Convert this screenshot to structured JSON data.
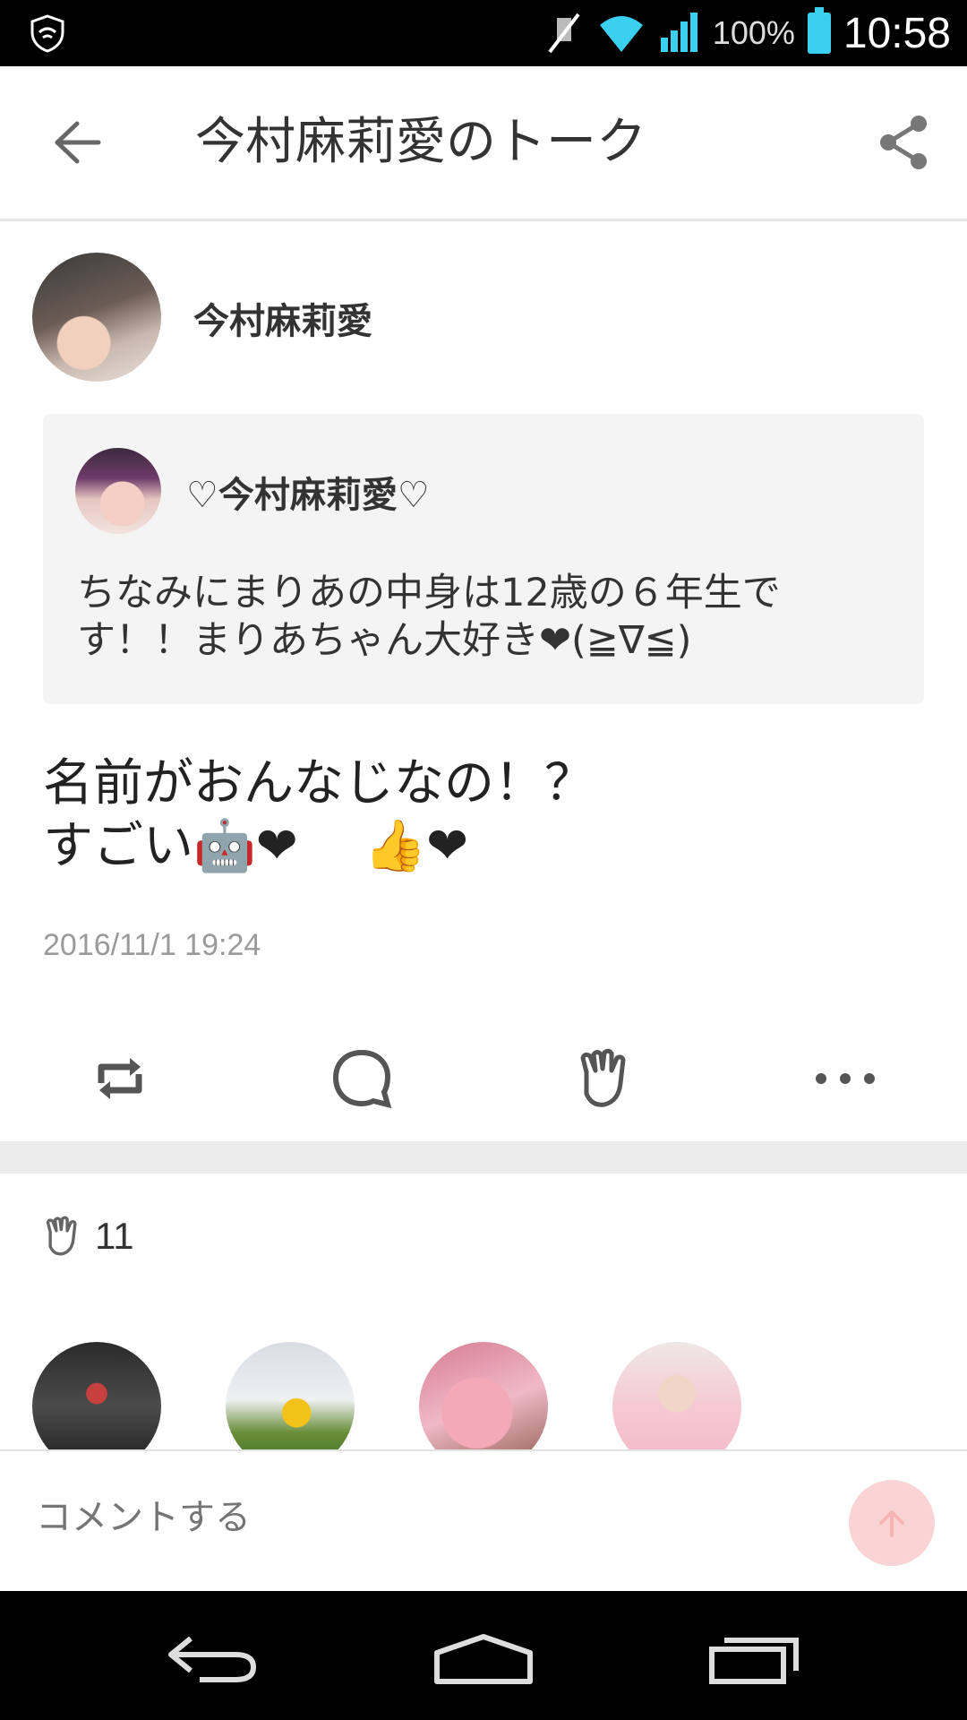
{
  "status_bar": {
    "battery_percent": "100%",
    "time": "10:58",
    "icons": [
      "shield-icon",
      "mute-icon",
      "wifi-icon",
      "signal-icon",
      "battery-icon"
    ]
  },
  "header": {
    "title": "今村麻莉愛のトーク",
    "back_icon": "arrow-left-icon",
    "share_icon": "share-icon"
  },
  "post": {
    "author_name": "今村麻莉愛",
    "quote": {
      "author_name": "♡今村麻莉愛♡",
      "text": "ちなみにまりあの中身は12歳の６年生です！！まりあちゃん大好き❤(≧∇≦)"
    },
    "body": "名前がおんなじなの！？\nすごい🤖❤　 👍❤",
    "timestamp": "2016/11/1 19:24"
  },
  "actions": [
    {
      "name": "repost",
      "icon": "repost-icon"
    },
    {
      "name": "comment",
      "icon": "comment-icon"
    },
    {
      "name": "clap",
      "icon": "clap-icon"
    },
    {
      "name": "more",
      "icon": "more-icon"
    }
  ],
  "clap_count": "11",
  "comment_bar": {
    "placeholder": "コメントする",
    "send_icon": "arrow-up-icon"
  },
  "colors": {
    "accent_send": "#fad4d4",
    "divider": "#ececec",
    "quote_bg": "#f4f4f4"
  }
}
